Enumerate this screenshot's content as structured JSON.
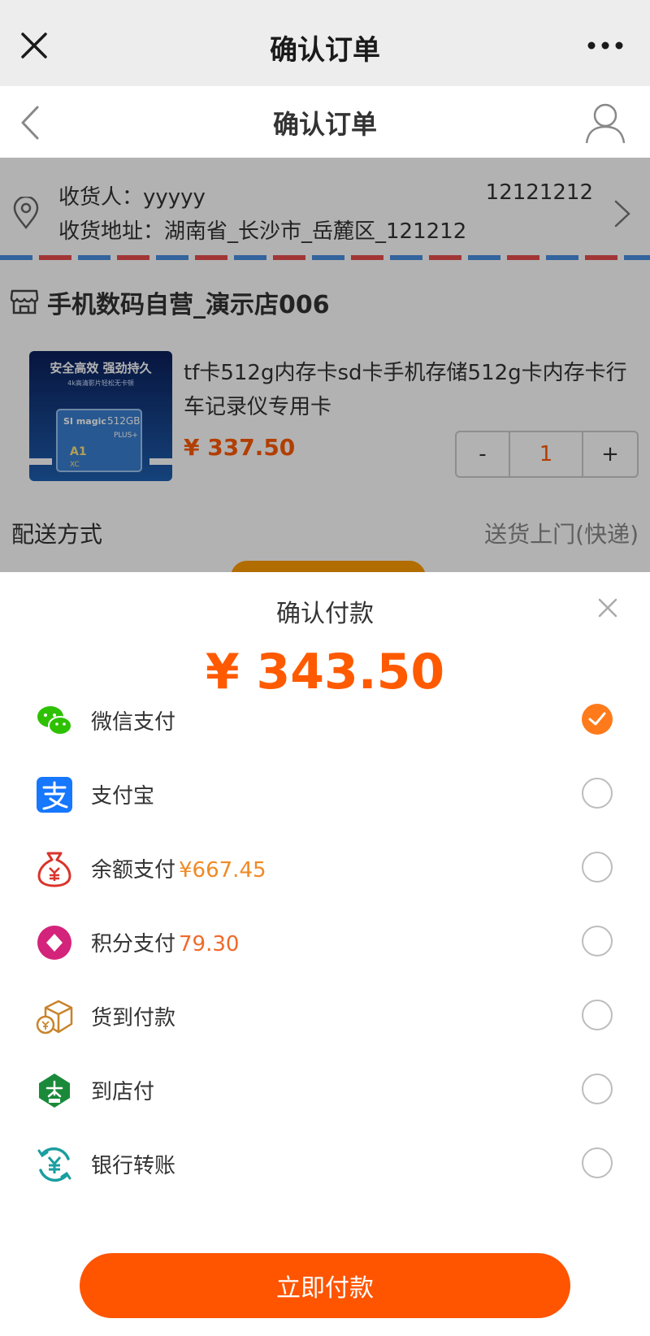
{
  "wechat_bar": {
    "title": "确认订单"
  },
  "header": {
    "title": "确认订单"
  },
  "address": {
    "recipient": "收货人：yyyyy",
    "phone": "12121212",
    "line": "收货地址：湖南省_长沙市_岳麓区_121212"
  },
  "store": {
    "name": "手机数码自营_演示店006"
  },
  "product": {
    "name": "tf卡512g内存卡sd卡手机存储512g卡内存卡行车记录仪专用卡",
    "price": "¥ 337.50",
    "image_text": {
      "line1": "安全高效 强劲持久",
      "line2": "4k高清影片轻松无卡顿",
      "brand": "SI magic",
      "capacity": "512GB",
      "tag": "PLUS+",
      "badge": "A1",
      "xc": "XC"
    },
    "stepper": {
      "minus": "-",
      "quantity": "1",
      "plus": "+"
    }
  },
  "delivery": {
    "label": "配送方式",
    "value": "送货上门(快递)"
  },
  "payment_sheet": {
    "title": "确认付款",
    "amount": "¥ 343.50",
    "methods": [
      {
        "label": "微信支付",
        "extra": "",
        "icon": "wechat-pay-icon",
        "selected": true
      },
      {
        "label": "支付宝",
        "extra": "",
        "icon": "alipay-icon",
        "selected": false
      },
      {
        "label": "余额支付",
        "extra": "¥667.45",
        "icon": "money-bag-icon",
        "selected": false
      },
      {
        "label": "积分支付",
        "extra": "79.30",
        "icon": "points-diamond-icon",
        "selected": false
      },
      {
        "label": "货到付款",
        "extra": "",
        "icon": "cash-on-delivery-box-icon",
        "selected": false
      },
      {
        "label": "到店付",
        "extra": "",
        "icon": "store-pay-icon",
        "selected": false
      },
      {
        "label": "银行转账",
        "extra": "",
        "icon": "bank-transfer-icon",
        "selected": false
      }
    ],
    "pay_button": "立即付款"
  },
  "colors": {
    "accent": "#ff5a00",
    "checked": "#ff7a1a",
    "wechat_green": "#2dc100",
    "alipay_blue": "#1677ff"
  }
}
